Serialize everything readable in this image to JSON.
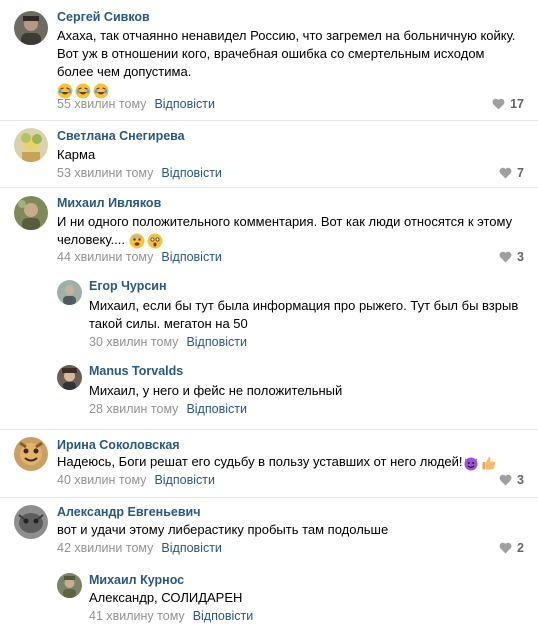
{
  "reply_label": "Відповісти",
  "comments": [
    {
      "author": "Сергей Сивков",
      "text": "Ахаха, так отчаянно ненавидел Россию, что загремел на больничную койку. Вот уж в отношении кого, врачебная ошибка со смертельным исходом более чем допустима.",
      "time": "55 хвилин тому",
      "likes": "17",
      "emoji": [
        "rofl-emoji",
        "rofl-emoji",
        "rofl-emoji"
      ]
    },
    {
      "author": "Светлана Снегирева",
      "text": "Карма",
      "time": "53 хвилини тому",
      "likes": "7"
    },
    {
      "author": "Михаил Ивляков",
      "text": "И ни одного положительного комментария. Вот как люди относятся к этому человеку....",
      "time": "44 хвилини тому",
      "likes": "3",
      "emoji": [
        "fearful-emoji",
        "astonished-emoji"
      ]
    },
    {
      "author": "Егор Чурсин",
      "text": "Михаил, если бы тут была информация про рыжего. Тут был бы взрыв такой силы. мегатон на 50",
      "time": "30 хвилин тому"
    },
    {
      "author": "Manus Torvalds",
      "text": "Михаил, у него и фейс не положительный",
      "time": "28 хвилин тому"
    },
    {
      "author": "Ирина Соколовская",
      "text": "Надеюсь, Боги решат его судьбу в пользу уставших от него людей!",
      "time": "40 хвилин тому",
      "likes": "3",
      "emoji": [
        "smiling-imp-emoji",
        "thumbs-up-emoji"
      ]
    },
    {
      "author": "Александр Евгеньевич",
      "text": "вот и удачи этому либерастику пробыть там подольше",
      "time": "42 хвилини тому",
      "likes": "2"
    },
    {
      "author": "Михаил Курнос",
      "text": "Александр, СОЛИДАРЕН",
      "time": "41 хвилину тому"
    }
  ],
  "colors": {
    "author_link": "#2a5885",
    "meta_gray": "#939393",
    "divider": "#e7e8ec"
  }
}
